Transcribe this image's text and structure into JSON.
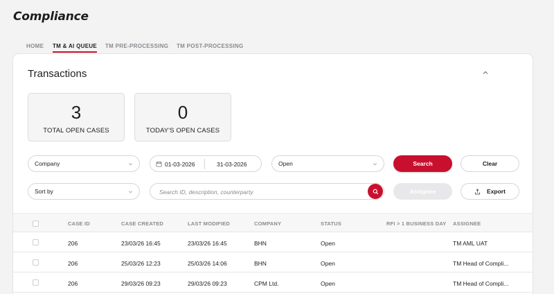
{
  "app": {
    "title": "Compliance"
  },
  "tabs": [
    {
      "label": "HOME",
      "active": false
    },
    {
      "label": "TM & AI QUEUE",
      "active": true
    },
    {
      "label": "TM PRE-PROCESSING",
      "active": false
    },
    {
      "label": "TM POST-PROCESSING",
      "active": false
    }
  ],
  "panel": {
    "title": "Transactions"
  },
  "stats": [
    {
      "value": "3",
      "label": "TOTAL OPEN CASES"
    },
    {
      "value": "0",
      "label": "TODAY'S OPEN CASES"
    }
  ],
  "filters": {
    "company": "Company",
    "date_from": "01-03-2026",
    "date_to": "31-03-2026",
    "status": "Open",
    "sort_by": "Sort by",
    "search_placeholder": "Search ID, description, counterparty"
  },
  "buttons": {
    "search": "Search",
    "clear": "Clear",
    "assignee": "Assignee",
    "export": "Export"
  },
  "colors": {
    "accent": "#c8102e"
  },
  "table": {
    "columns": [
      "CASE ID",
      "CASE CREATED",
      "LAST MODIFIED",
      "COMPANY",
      "STATUS",
      "RFI > 1 BUSINESS DAY",
      "ASSIGNEE"
    ],
    "rows": [
      {
        "case_id": "206",
        "created": "23/03/26  16:45",
        "modified": "23/03/26  16:45",
        "company": "BHN",
        "status": "Open",
        "rfi": "",
        "assignee": "TM AML UAT"
      },
      {
        "case_id": "206",
        "created": "25/03/26  12:23",
        "modified": "25/03/26  14:06",
        "company": "BHN",
        "status": "Open",
        "rfi": "",
        "assignee": "TM Head of Compli..."
      },
      {
        "case_id": "206",
        "created": "29/03/26  09:23",
        "modified": "29/03/26  09:23",
        "company": "CPM Ltd.",
        "status": "Open",
        "rfi": "",
        "assignee": "TM Head of Compli..."
      }
    ]
  }
}
